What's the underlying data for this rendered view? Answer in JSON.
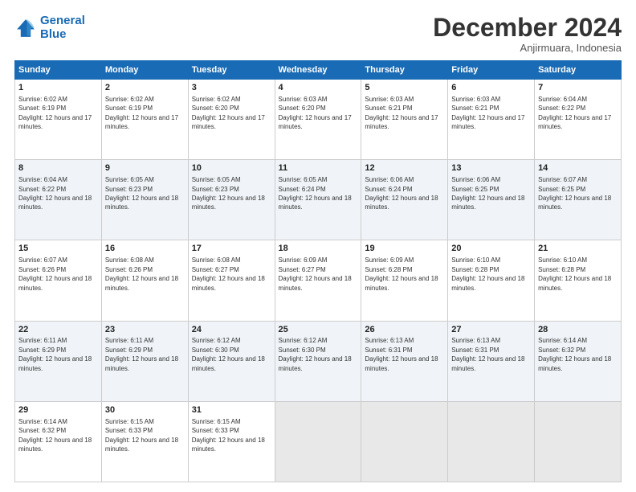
{
  "header": {
    "logo_line1": "General",
    "logo_line2": "Blue",
    "title": "December 2024",
    "location": "Anjirmuara, Indonesia"
  },
  "days_of_week": [
    "Sunday",
    "Monday",
    "Tuesday",
    "Wednesday",
    "Thursday",
    "Friday",
    "Saturday"
  ],
  "weeks": [
    [
      {
        "day": "1",
        "sunrise": "6:02 AM",
        "sunset": "6:19 PM",
        "daylight": "12 hours and 17 minutes."
      },
      {
        "day": "2",
        "sunrise": "6:02 AM",
        "sunset": "6:19 PM",
        "daylight": "12 hours and 17 minutes."
      },
      {
        "day": "3",
        "sunrise": "6:02 AM",
        "sunset": "6:20 PM",
        "daylight": "12 hours and 17 minutes."
      },
      {
        "day": "4",
        "sunrise": "6:03 AM",
        "sunset": "6:20 PM",
        "daylight": "12 hours and 17 minutes."
      },
      {
        "day": "5",
        "sunrise": "6:03 AM",
        "sunset": "6:21 PM",
        "daylight": "12 hours and 17 minutes."
      },
      {
        "day": "6",
        "sunrise": "6:03 AM",
        "sunset": "6:21 PM",
        "daylight": "12 hours and 17 minutes."
      },
      {
        "day": "7",
        "sunrise": "6:04 AM",
        "sunset": "6:22 PM",
        "daylight": "12 hours and 17 minutes."
      }
    ],
    [
      {
        "day": "8",
        "sunrise": "6:04 AM",
        "sunset": "6:22 PM",
        "daylight": "12 hours and 18 minutes."
      },
      {
        "day": "9",
        "sunrise": "6:05 AM",
        "sunset": "6:23 PM",
        "daylight": "12 hours and 18 minutes."
      },
      {
        "day": "10",
        "sunrise": "6:05 AM",
        "sunset": "6:23 PM",
        "daylight": "12 hours and 18 minutes."
      },
      {
        "day": "11",
        "sunrise": "6:05 AM",
        "sunset": "6:24 PM",
        "daylight": "12 hours and 18 minutes."
      },
      {
        "day": "12",
        "sunrise": "6:06 AM",
        "sunset": "6:24 PM",
        "daylight": "12 hours and 18 minutes."
      },
      {
        "day": "13",
        "sunrise": "6:06 AM",
        "sunset": "6:25 PM",
        "daylight": "12 hours and 18 minutes."
      },
      {
        "day": "14",
        "sunrise": "6:07 AM",
        "sunset": "6:25 PM",
        "daylight": "12 hours and 18 minutes."
      }
    ],
    [
      {
        "day": "15",
        "sunrise": "6:07 AM",
        "sunset": "6:26 PM",
        "daylight": "12 hours and 18 minutes."
      },
      {
        "day": "16",
        "sunrise": "6:08 AM",
        "sunset": "6:26 PM",
        "daylight": "12 hours and 18 minutes."
      },
      {
        "day": "17",
        "sunrise": "6:08 AM",
        "sunset": "6:27 PM",
        "daylight": "12 hours and 18 minutes."
      },
      {
        "day": "18",
        "sunrise": "6:09 AM",
        "sunset": "6:27 PM",
        "daylight": "12 hours and 18 minutes."
      },
      {
        "day": "19",
        "sunrise": "6:09 AM",
        "sunset": "6:28 PM",
        "daylight": "12 hours and 18 minutes."
      },
      {
        "day": "20",
        "sunrise": "6:10 AM",
        "sunset": "6:28 PM",
        "daylight": "12 hours and 18 minutes."
      },
      {
        "day": "21",
        "sunrise": "6:10 AM",
        "sunset": "6:28 PM",
        "daylight": "12 hours and 18 minutes."
      }
    ],
    [
      {
        "day": "22",
        "sunrise": "6:11 AM",
        "sunset": "6:29 PM",
        "daylight": "12 hours and 18 minutes."
      },
      {
        "day": "23",
        "sunrise": "6:11 AM",
        "sunset": "6:29 PM",
        "daylight": "12 hours and 18 minutes."
      },
      {
        "day": "24",
        "sunrise": "6:12 AM",
        "sunset": "6:30 PM",
        "daylight": "12 hours and 18 minutes."
      },
      {
        "day": "25",
        "sunrise": "6:12 AM",
        "sunset": "6:30 PM",
        "daylight": "12 hours and 18 minutes."
      },
      {
        "day": "26",
        "sunrise": "6:13 AM",
        "sunset": "6:31 PM",
        "daylight": "12 hours and 18 minutes."
      },
      {
        "day": "27",
        "sunrise": "6:13 AM",
        "sunset": "6:31 PM",
        "daylight": "12 hours and 18 minutes."
      },
      {
        "day": "28",
        "sunrise": "6:14 AM",
        "sunset": "6:32 PM",
        "daylight": "12 hours and 18 minutes."
      }
    ],
    [
      {
        "day": "29",
        "sunrise": "6:14 AM",
        "sunset": "6:32 PM",
        "daylight": "12 hours and 18 minutes."
      },
      {
        "day": "30",
        "sunrise": "6:15 AM",
        "sunset": "6:33 PM",
        "daylight": "12 hours and 18 minutes."
      },
      {
        "day": "31",
        "sunrise": "6:15 AM",
        "sunset": "6:33 PM",
        "daylight": "12 hours and 18 minutes."
      },
      null,
      null,
      null,
      null
    ]
  ]
}
